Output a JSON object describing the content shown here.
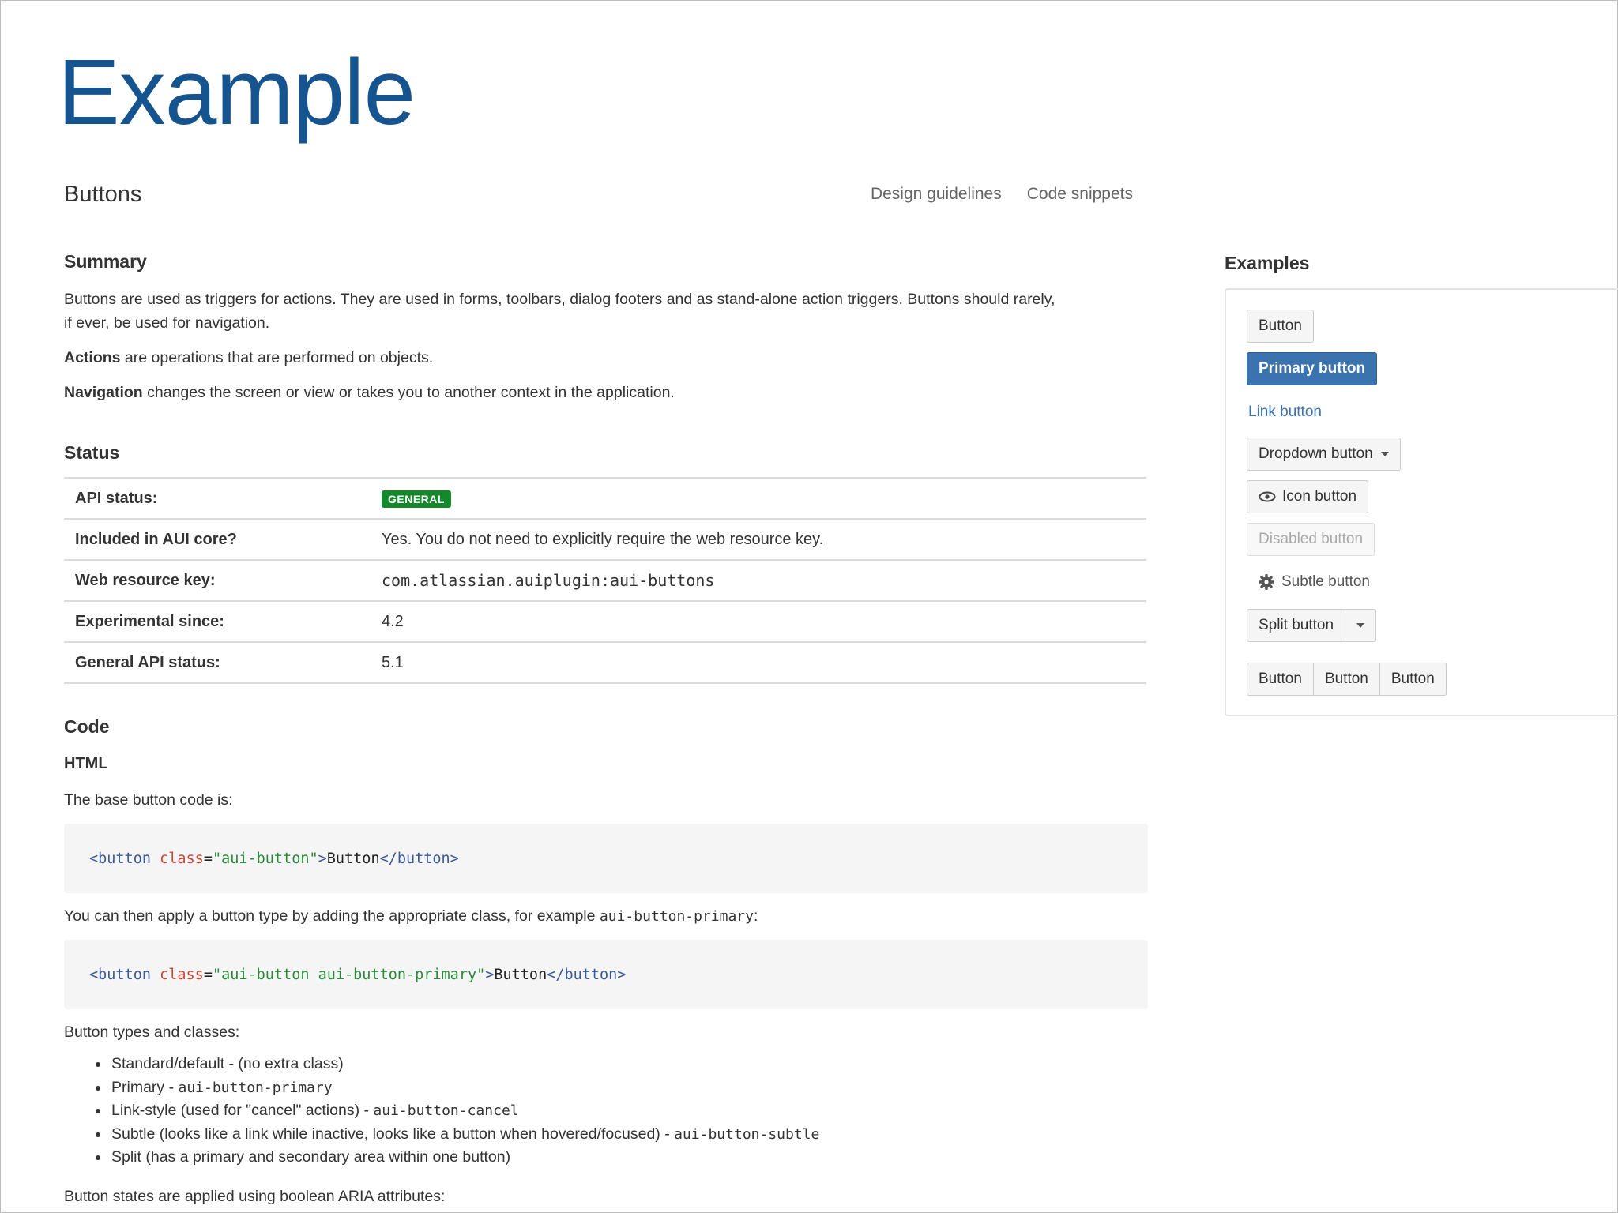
{
  "slide": {
    "title": "Example"
  },
  "header": {
    "heading": "Buttons",
    "links": [
      "Design guidelines",
      "Code snippets"
    ]
  },
  "summary": {
    "title": "Summary",
    "p1_line1": "Buttons are used as triggers for actions. They are used in forms, toolbars, dialog footers and as stand-alone action triggers. Buttons should rarely,",
    "p1_line2": "if ever, be used for navigation.",
    "actions_bold": "Actions",
    "actions_rest": " are operations that are performed on objects.",
    "nav_bold": "Navigation",
    "nav_rest": " changes the screen or view or takes you to another context in the application."
  },
  "status": {
    "title": "Status",
    "rows": [
      {
        "key": "API status:",
        "value": "GENERAL"
      },
      {
        "key": "Included in AUI core?",
        "value": "Yes. You do not need to explicitly require the web resource key."
      },
      {
        "key": "Web resource key:",
        "value": "com.atlassian.auiplugin:aui-buttons"
      },
      {
        "key": "Experimental since:",
        "value": "4.2"
      },
      {
        "key": "General API status:",
        "value": "5.1"
      }
    ]
  },
  "code": {
    "title": "Code",
    "subtitle": "HTML",
    "intro": "The base button code is:",
    "snippet1": {
      "open_tag": "<button",
      "attr": "class",
      "eq": "=",
      "value": "\"aui-button\"",
      "close_open": ">",
      "text": "Button",
      "end_tag": "</button>"
    },
    "apply_text": "You can then apply a button type by adding the appropriate class, for example ",
    "apply_code": "aui-button-primary",
    "apply_end": ":",
    "snippet2": {
      "open_tag": "<button",
      "attr": "class",
      "eq": "=",
      "value": "\"aui-button aui-button-primary\"",
      "close_open": ">",
      "text": "Button",
      "end_tag": "</button>"
    },
    "types_intro": "Button types and classes:",
    "types": [
      {
        "text": "Standard/default - (no extra class)",
        "code": ""
      },
      {
        "text": "Primary - ",
        "code": "aui-button-primary"
      },
      {
        "text": "Link-style (used for \"cancel\" actions) - ",
        "code": "aui-button-cancel"
      },
      {
        "text": "Subtle (looks like a link while inactive, looks like a button when hovered/focused) - ",
        "code": "aui-button-subtle"
      },
      {
        "text": "Split (has a primary and secondary area within one button)",
        "code": ""
      }
    ],
    "states_intro": "Button states are applied using boolean ARIA attributes:"
  },
  "examples": {
    "title": "Examples",
    "button": "Button",
    "primary": "Primary button",
    "link": "Link button",
    "dropdown": "Dropdown button",
    "icon": "Icon button",
    "disabled": "Disabled button",
    "subtle": "Subtle button",
    "split": "Split button",
    "group": [
      "Button",
      "Button",
      "Button"
    ]
  }
}
